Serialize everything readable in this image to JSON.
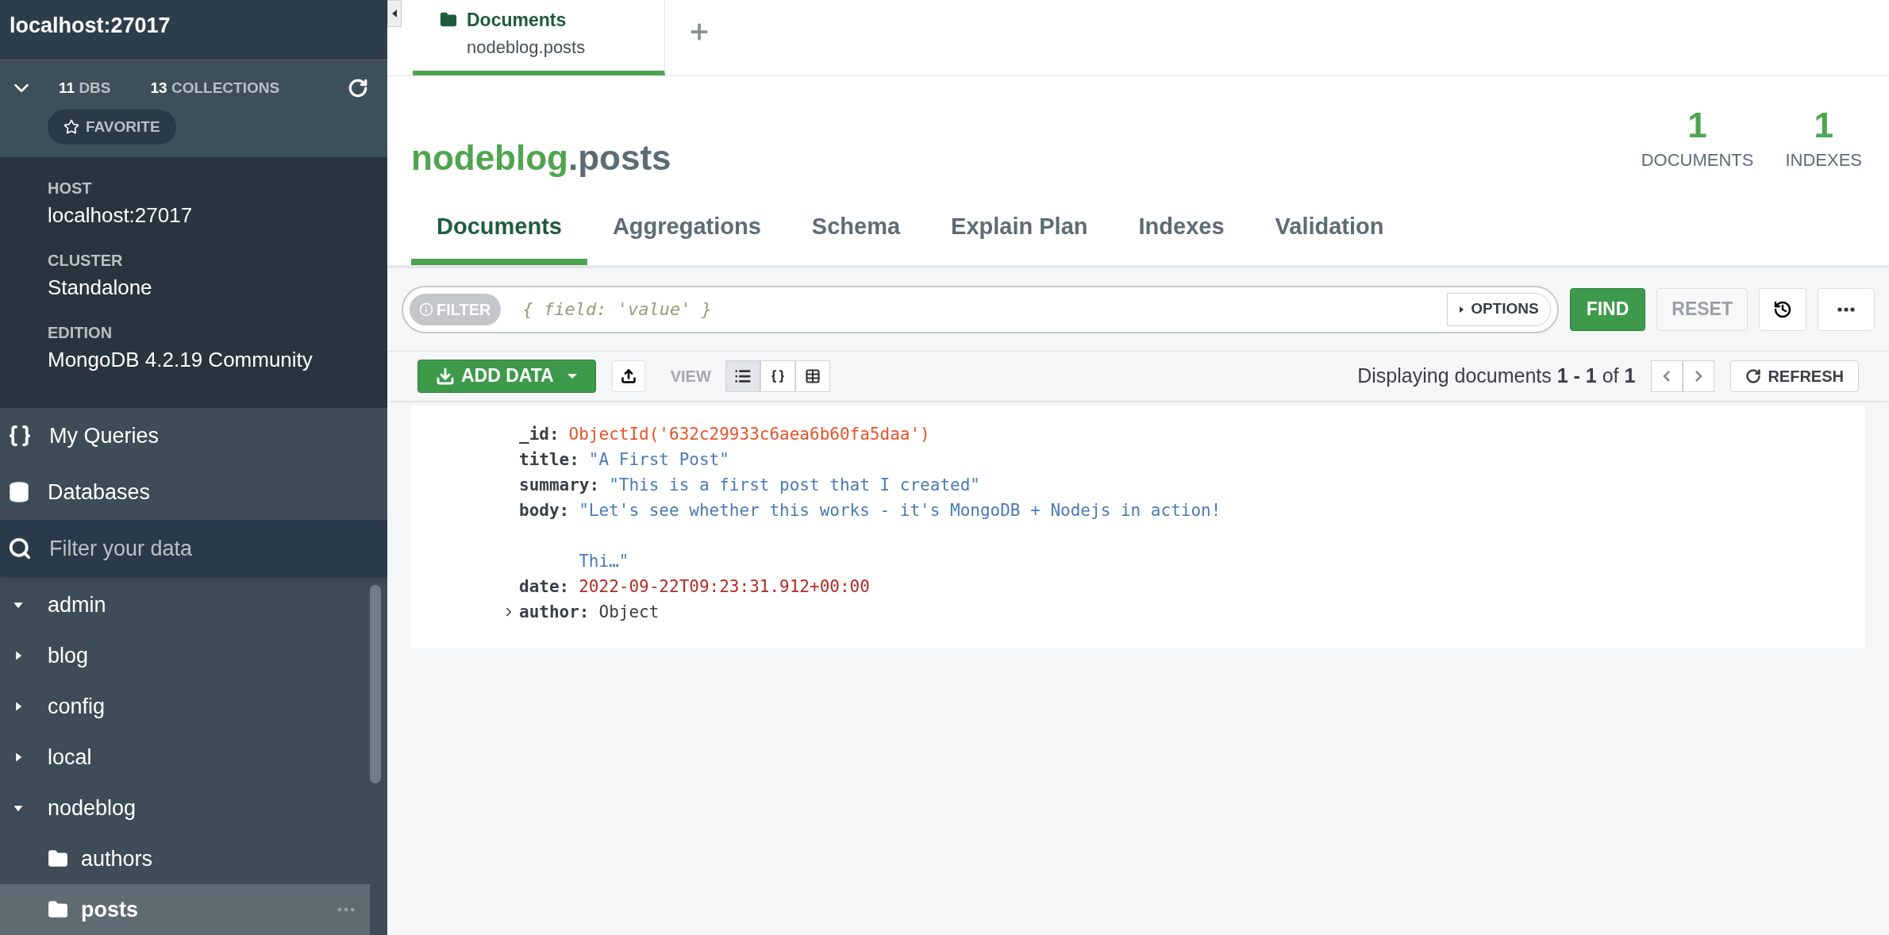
{
  "sidebar": {
    "connection_title": "localhost:27017",
    "stats": [
      {
        "count": "11",
        "label": "DBS"
      },
      {
        "count": "13",
        "label": "COLLECTIONS"
      }
    ],
    "favorite_button": "FAVORITE",
    "info": [
      {
        "label": "HOST",
        "value": "localhost:27017"
      },
      {
        "label": "CLUSTER",
        "value": "Standalone"
      },
      {
        "label": "EDITION",
        "value": "MongoDB 4.2.19 Community"
      }
    ],
    "nav": [
      {
        "kind": "queries",
        "label": "My Queries"
      },
      {
        "kind": "databases",
        "label": "Databases"
      }
    ],
    "filter": {
      "placeholder": "Filter your data"
    },
    "tree": [
      {
        "label": "admin",
        "expanded": true,
        "selected": false
      },
      {
        "label": "blog",
        "expanded": false,
        "selected": false
      },
      {
        "label": "config",
        "expanded": false,
        "selected": false
      },
      {
        "label": "local",
        "expanded": false,
        "selected": false
      },
      {
        "label": "nodeblog",
        "expanded": true,
        "selected": false,
        "children": [
          {
            "label": "authors",
            "selected": false
          },
          {
            "label": "posts",
            "selected": true
          }
        ]
      }
    ]
  },
  "workspace_tabs": [
    {
      "title": "Documents",
      "subtitle": "nodeblog.posts",
      "selected": true
    }
  ],
  "collection": {
    "database": "nodeblog",
    "name": ".posts",
    "stats": [
      {
        "value": "1",
        "label": "DOCUMENTS"
      },
      {
        "value": "1",
        "label": "INDEXES"
      }
    ],
    "tabs": [
      {
        "label": "Documents",
        "selected": true
      },
      {
        "label": "Aggregations",
        "selected": false
      },
      {
        "label": "Schema",
        "selected": false
      },
      {
        "label": "Explain Plan",
        "selected": false
      },
      {
        "label": "Indexes",
        "selected": false
      },
      {
        "label": "Validation",
        "selected": false
      }
    ]
  },
  "query_bar": {
    "filter_label": "FILTER",
    "placeholder": "{ field: 'value' }",
    "options": "OPTIONS",
    "find": "FIND",
    "reset": "RESET"
  },
  "toolbar": {
    "add_data": "ADD DATA",
    "view_label": "VIEW",
    "views": [
      {
        "kind": "list",
        "selected": true
      },
      {
        "kind": "json",
        "selected": false
      },
      {
        "kind": "table",
        "selected": false
      }
    ],
    "status": "Displaying documents **1 - 1** of **1**",
    "refresh": "REFRESH"
  },
  "document": {
    "fields": [
      {
        "key": "_id:",
        "value": "ObjectId('632c29933c6aea6b60fa5daa')",
        "kind": "objectid"
      },
      {
        "key": "title:",
        "value": "\"A First Post\"",
        "kind": "string"
      },
      {
        "key": "summary:",
        "value": "\"This is a first post that I created\"",
        "kind": "string"
      },
      {
        "key": "body:",
        "value": "\"Let's see whether this works - it's MongoDB + Nodejs in action!\n\nThi…\"",
        "kind": "string"
      },
      {
        "key": "date:",
        "value": "2022-09-22T09:23:31.912+00:00",
        "kind": "date"
      },
      {
        "key": "author:",
        "value": "Object",
        "kind": "object",
        "expanded": false
      }
    ]
  }
}
